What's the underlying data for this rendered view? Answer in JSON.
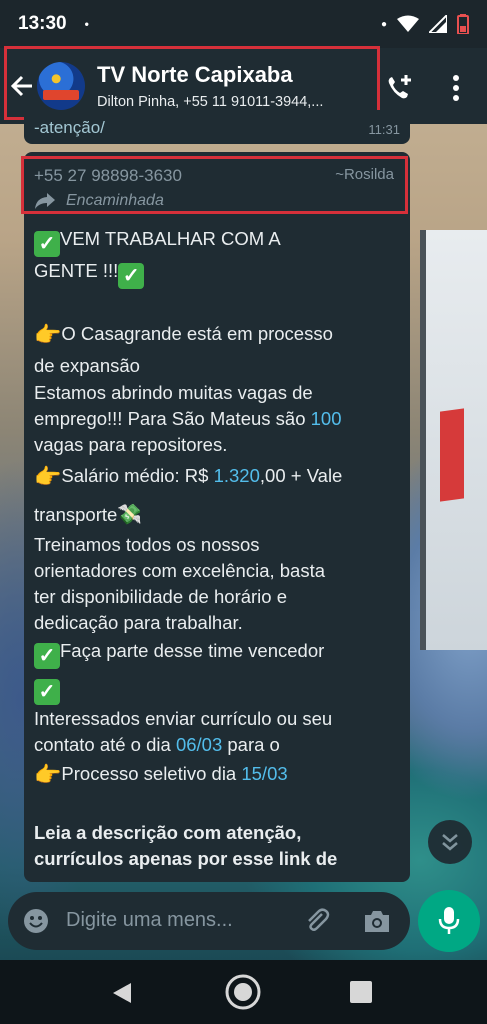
{
  "status_bar": {
    "time": "13:30",
    "dot": "•"
  },
  "header": {
    "title": "TV Norte Capixaba",
    "subtitle": "Dilton Pinha, +55 11 91011-3944,..."
  },
  "previous_message": {
    "text": "-atenção/",
    "time": "11:31"
  },
  "message": {
    "sender_phone": "+55 27 98898-3630",
    "sender_name": "~Rosilda",
    "forwarded_label": "Encaminhada",
    "lines": {
      "l1": "VEM TRABALHAR COM A",
      "l2": "GENTE !!!",
      "l3": "O Casagrande está em processo",
      "l4": "de expansão",
      "l5": "Estamos abrindo muitas vagas de",
      "l6a": "emprego!!! Para São Mateus são ",
      "l6b": "100",
      "l7": "vagas para repositores.",
      "l8a": "Salário médio: R$ ",
      "l8b": "1.320",
      "l8c": ",00 + Vale",
      "l9": "transporte",
      "l10": "Treinamos todos os nossos",
      "l11": "orientadores com excelência, basta",
      "l12": "ter disponibilidade de horário e",
      "l13": "dedicação para trabalhar.",
      "l14": "Faça parte desse time vencedor",
      "l15": "Interessados enviar currículo ou seu",
      "l16a": "contato até o dia ",
      "l16b": "06/03",
      "l16c": " para o",
      "l17a": "Processo seletivo dia ",
      "l17b": "15/03",
      "l18": "Leia a descrição com atenção,",
      "l19": "currículos apenas por esse link de"
    }
  },
  "input": {
    "placeholder": "Digite uma mens..."
  },
  "colors": {
    "accent": "#00a884",
    "highlight_box": "#d6303a",
    "link": "#53bdeb",
    "bubble": "#1f2c33"
  },
  "icons": [
    "back-arrow-icon",
    "add-call-icon",
    "more-vert-icon",
    "forward-icon",
    "check-mark-icon",
    "pointing-hand-icon",
    "money-icon",
    "scroll-down-icon",
    "emoji-icon",
    "attach-icon",
    "camera-icon",
    "mic-icon",
    "nav-back-icon",
    "nav-home-icon",
    "nav-recents-icon"
  ]
}
